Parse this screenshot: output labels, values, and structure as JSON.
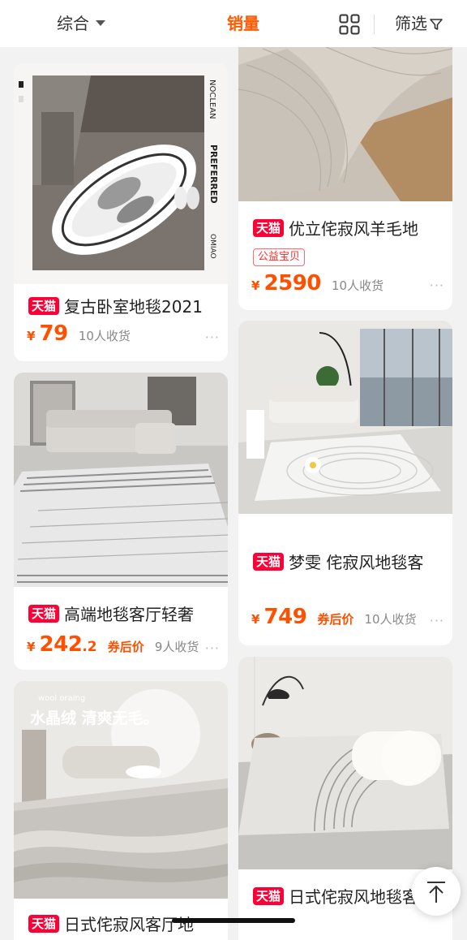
{
  "filter_bar": {
    "composite_label": "综合",
    "sales_label": "销量",
    "filter_label": "筛选"
  },
  "colors": {
    "accent": "#ff5000",
    "tmall_red": "#ff0036",
    "active_tab": "#ff5a00"
  },
  "icons": {
    "composite_caret": "caret-down-icon",
    "layout_toggle": "grid-view-icon",
    "filter": "funnel-icon",
    "more": "ellipsis-icon",
    "back_to_top": "arrow-up-icon"
  },
  "left_cards": [
    {
      "image_text": {
        "brand_vertical": "NOCLEAN",
        "side_text": "PREFERRED",
        "bottom_text": "OMIAO"
      },
      "tag": "天猫",
      "title": "复古卧室地毯2021",
      "currency": "¥",
      "price": "79",
      "sold": "10人收货",
      "more": "···"
    },
    {
      "tag": "天猫",
      "title": "高端地毯客厅轻奢",
      "currency": "¥",
      "price": "242",
      "price_decimal": ".2",
      "coupon_label": "券后价",
      "sold": "9人收货",
      "more": "···"
    },
    {
      "image_text": {
        "headline": "水晶绒 清爽无毛。",
        "small_caption": "wool oraing"
      },
      "tag": "天猫",
      "title": "日式侘寂风客厅地"
    }
  ],
  "right_cards": [
    {
      "tag": "天猫",
      "title": "优立侘寂风羊毛地",
      "badge": "公益宝贝",
      "currency": "¥",
      "price": "2590",
      "sold": "10人收货",
      "more": "···"
    },
    {
      "tag": "天猫",
      "title": "梦雯 侘寂风地毯客",
      "currency": "¥",
      "price": "749",
      "coupon_label": "券后价",
      "sold": "10人收货",
      "more": "···"
    },
    {
      "tag": "天猫",
      "title": "日式侘寂风地毯客"
    }
  ]
}
